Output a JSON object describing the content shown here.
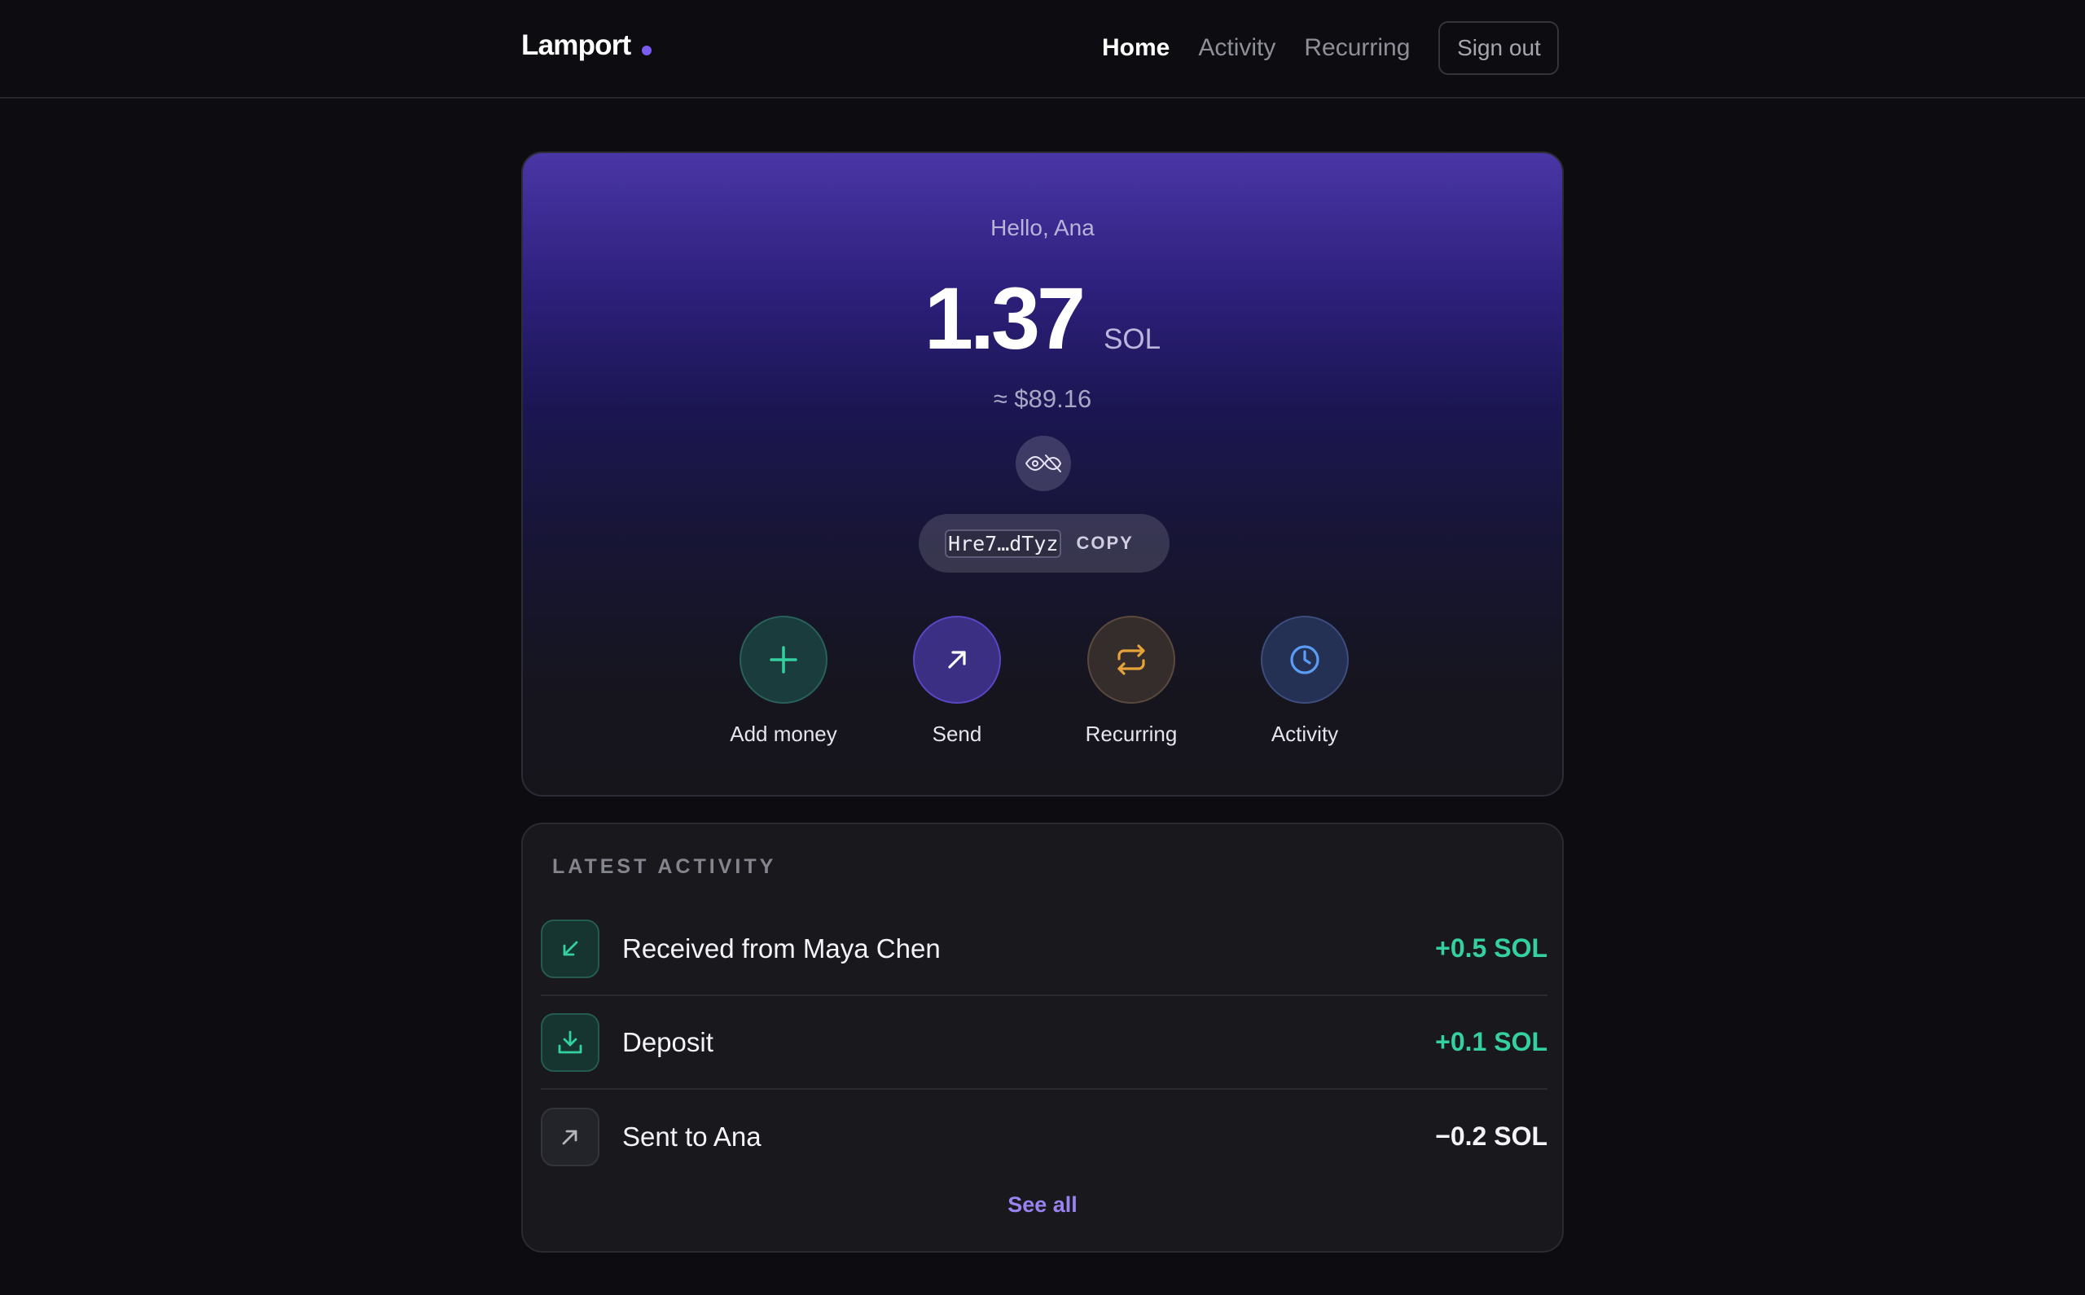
{
  "header": {
    "brand": "Lamport",
    "nav": [
      {
        "label": "Home",
        "active": true
      },
      {
        "label": "Activity",
        "active": false
      },
      {
        "label": "Recurring",
        "active": false
      }
    ],
    "sign_out_label": "Sign out"
  },
  "balance": {
    "greeting": "Hello, Ana",
    "amount": "1.37",
    "unit": "SOL",
    "fiat": "≈ $89.16",
    "toggle_icon": "eye-off-icon",
    "address": "Hre7…dTyz",
    "copy_label": "COPY"
  },
  "actions": [
    {
      "label": "Add money",
      "icon": "plus-icon",
      "color": "#34d0a0"
    },
    {
      "label": "Send",
      "icon": "arrow-up-right-icon",
      "color": "#ffffff"
    },
    {
      "label": "Recurring",
      "icon": "repeat-icon",
      "color": "#e8a23a"
    },
    {
      "label": "Activity",
      "icon": "clock-icon",
      "color": "#5b9cf5"
    }
  ],
  "activity": {
    "title": "LATEST ACTIVITY",
    "items": [
      {
        "label": "Received from Maya Chen",
        "amount": "+0.5 SOL",
        "icon": "arrow-down-left-icon",
        "direction": "in"
      },
      {
        "label": "Deposit",
        "amount": "+0.1 SOL",
        "icon": "download-icon",
        "direction": "in"
      },
      {
        "label": "Sent to Ana",
        "amount": "−0.2 SOL",
        "icon": "arrow-up-right-icon",
        "direction": "out"
      }
    ],
    "see_all_label": "See all"
  },
  "colors": {
    "accent": "#7b5cf0",
    "positive": "#34d0a0",
    "link": "#9a82f0"
  }
}
